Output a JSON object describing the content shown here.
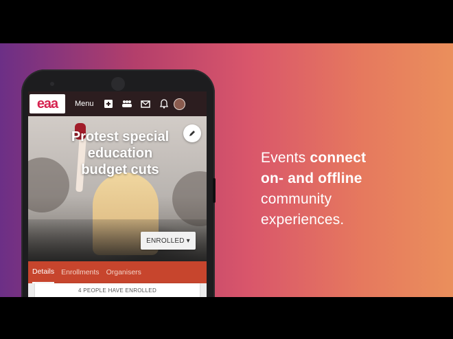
{
  "app": {
    "logo_text": "eaa",
    "menu_label": "Menu",
    "icons": {
      "add": "plus-square-icon",
      "people": "people-icon",
      "mail": "mail-icon",
      "bell": "bell-icon",
      "avatar": "user-avatar"
    }
  },
  "event": {
    "title_line1": "Protest special",
    "title_line2": "education",
    "title_line3": "budget cuts",
    "enroll_button": "ENROLLED ▾"
  },
  "tabs": [
    {
      "label": "Details",
      "active": true
    },
    {
      "label": "Enrollments",
      "active": false
    },
    {
      "label": "Organisers",
      "active": false
    }
  ],
  "enrolled_count_text": "4 PEOPLE HAVE ENROLLED",
  "tagline": {
    "part1": "Events ",
    "part2_bold": "connect",
    "part3_bold": "on- and offline",
    "part4": "community",
    "part5": "experiences."
  },
  "colors": {
    "gradient_start": "#6c2f86",
    "gradient_mid": "#d9566b",
    "gradient_end": "#ea8f5c",
    "brand_red": "#d6224f",
    "tabs_bar": "#c7452d",
    "header_dark": "#2c1d1f"
  }
}
